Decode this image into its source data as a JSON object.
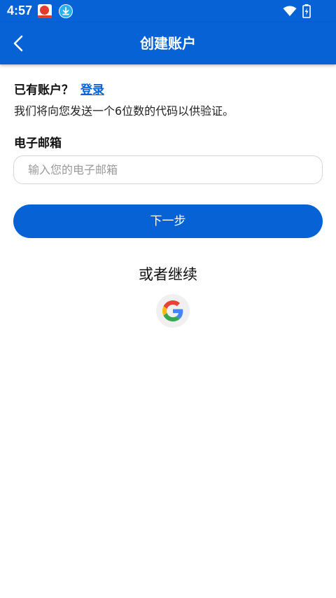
{
  "status_bar": {
    "time": "4:57",
    "icons": [
      "app-notification-icon",
      "download-icon",
      "wifi-icon",
      "battery-charging-icon"
    ]
  },
  "app_bar": {
    "title": "创建账户",
    "back_icon": "chevron-left-icon"
  },
  "login_prompt": {
    "question": "已有账户？",
    "link": "登录"
  },
  "info_text": "我们将向您发送一个6位数的代码以供验证。",
  "email": {
    "label": "电子邮箱",
    "placeholder": "输入您的电子邮箱",
    "value": ""
  },
  "next_button": "下一步",
  "or_continue": "或者继续",
  "social": {
    "google_icon": "google-icon"
  },
  "colors": {
    "primary": "#0762d6",
    "background": "#ffffff",
    "input_border": "#d6d6d6"
  }
}
